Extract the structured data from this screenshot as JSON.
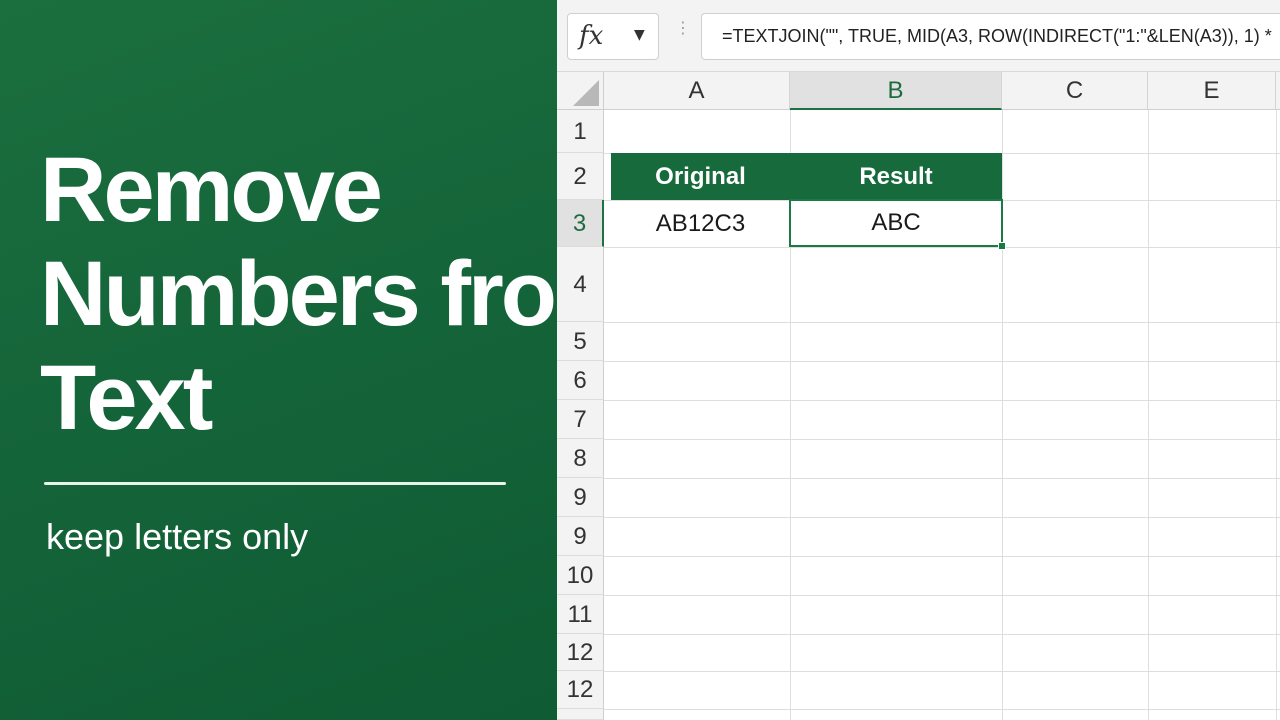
{
  "promo": {
    "title_lines": [
      "Remove",
      "Numbers from",
      "Text"
    ],
    "subtitle": "keep letters only",
    "background": "#166a3c"
  },
  "formula_bar": {
    "function_glyph": "fx",
    "caret": "▼",
    "formula": "=TEXTJOIN(\"\", TRUE, MID(A3, ROW(INDIRECT(\"1:\"&LEN(A3)), 1) *"
  },
  "columns": [
    {
      "label": "A"
    },
    {
      "label": "B",
      "active": true
    },
    {
      "label": "C"
    },
    {
      "label": "E"
    }
  ],
  "rows": [
    "1",
    "2",
    "3",
    "4",
    "5",
    "6",
    "7",
    "8",
    "9",
    "9",
    "10",
    "11",
    "12",
    "12"
  ],
  "active_row": "3",
  "table": {
    "header_original": "Original",
    "header_result": "Result",
    "original_value": "AB12C3",
    "result_value": "ABC"
  },
  "colors": {
    "accent_green": "#1a7a45",
    "header_fill": "#166a3c"
  }
}
